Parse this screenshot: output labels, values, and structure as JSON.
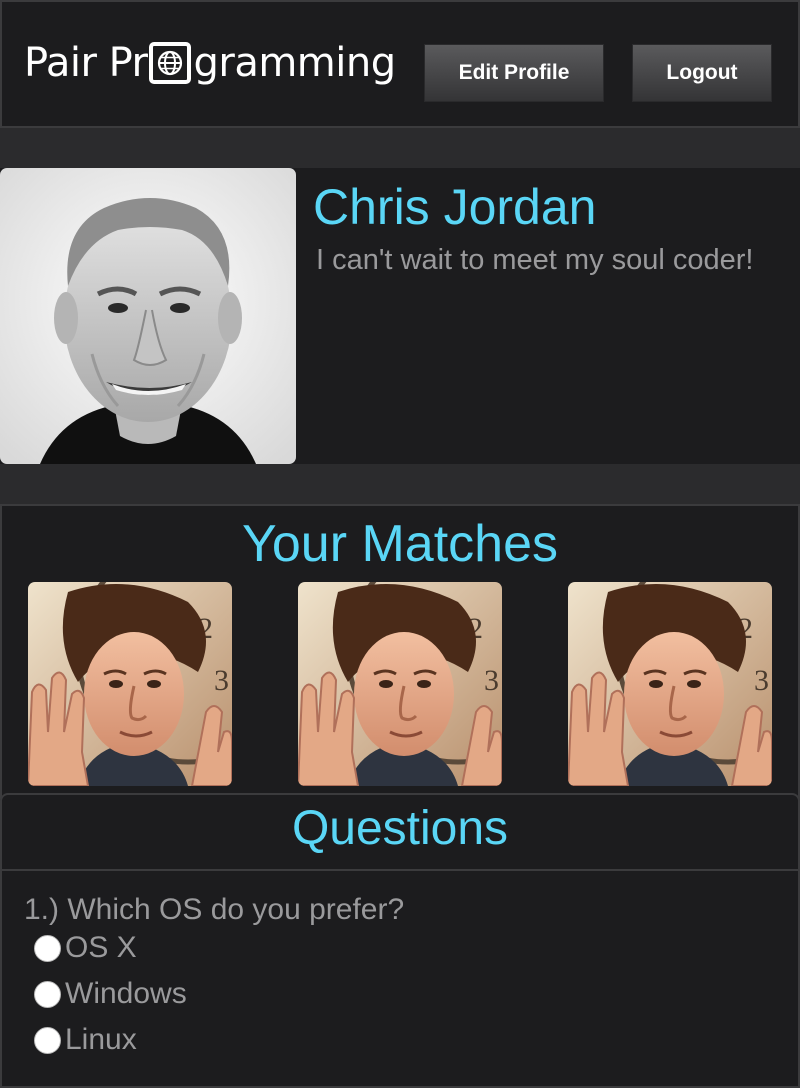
{
  "header": {
    "brand_prefix": "Pair Pr",
    "brand_suffix": "gramming",
    "logo_icon": "globe-icon",
    "edit_profile_label": "Edit Profile",
    "logout_label": "Logout"
  },
  "profile": {
    "name": "Chris Jordan",
    "bio": "I can't wait to meet my soul coder!"
  },
  "matches": {
    "title": "Your Matches",
    "count": 3
  },
  "questions": {
    "title": "Questions",
    "items": [
      {
        "question": "1.) Which OS do you prefer?",
        "options": [
          "OS X",
          "Windows",
          "Linux"
        ]
      }
    ]
  },
  "colors": {
    "accent": "#5ad6f6",
    "page_bg": "#2b2b2d",
    "panel_bg": "#1c1c1e",
    "muted_text": "#9a9a9c"
  }
}
